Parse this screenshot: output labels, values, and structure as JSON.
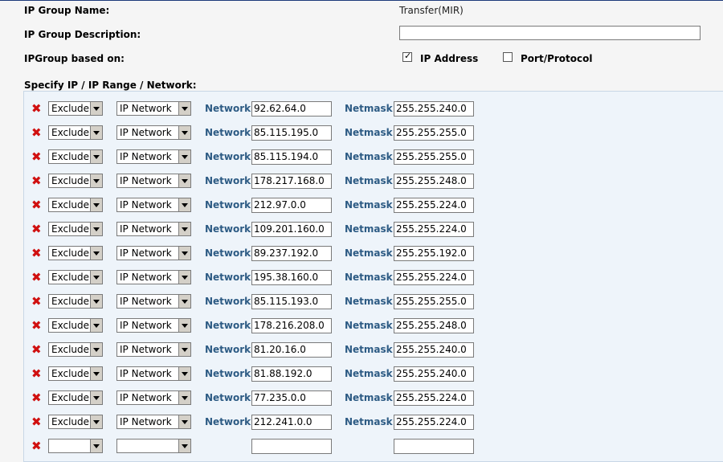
{
  "form": {
    "group_name_label": "IP Group Name:",
    "group_name_value": "Transfer(MIR)",
    "group_desc_label": "IP Group Description:",
    "group_desc_value": "",
    "based_on_label": "IPGroup based on:",
    "ip_address_label": "IP Address",
    "ip_address_checked": true,
    "ip_address_mark": "✓",
    "port_protocol_label": "Port/Protocol",
    "port_protocol_checked": false,
    "specify_label": "Specify IP / IP Range / Network:"
  },
  "colors": {
    "field_label": "#2d5b84",
    "delete_icon": "#d01010",
    "panel_bg": "#eef4fa"
  },
  "rows": [
    {
      "action": "Exclude",
      "type": "IP Network",
      "network_label": "Network",
      "network": "92.62.64.0",
      "netmask_label": "Netmask",
      "netmask": "255.255.240.0"
    },
    {
      "action": "Exclude",
      "type": "IP Network",
      "network_label": "Network",
      "network": "85.115.195.0",
      "netmask_label": "Netmask",
      "netmask": "255.255.255.0"
    },
    {
      "action": "Exclude",
      "type": "IP Network",
      "network_label": "Network",
      "network": "85.115.194.0",
      "netmask_label": "Netmask",
      "netmask": "255.255.255.0"
    },
    {
      "action": "Exclude",
      "type": "IP Network",
      "network_label": "Network",
      "network": "178.217.168.0",
      "netmask_label": "Netmask",
      "netmask": "255.255.248.0"
    },
    {
      "action": "Exclude",
      "type": "IP Network",
      "network_label": "Network",
      "network": "212.97.0.0",
      "netmask_label": "Netmask",
      "netmask": "255.255.224.0"
    },
    {
      "action": "Exclude",
      "type": "IP Network",
      "network_label": "Network",
      "network": "109.201.160.0",
      "netmask_label": "Netmask",
      "netmask": "255.255.224.0"
    },
    {
      "action": "Exclude",
      "type": "IP Network",
      "network_label": "Network",
      "network": "89.237.192.0",
      "netmask_label": "Netmask",
      "netmask": "255.255.192.0"
    },
    {
      "action": "Exclude",
      "type": "IP Network",
      "network_label": "Network",
      "network": "195.38.160.0",
      "netmask_label": "Netmask",
      "netmask": "255.255.224.0"
    },
    {
      "action": "Exclude",
      "type": "IP Network",
      "network_label": "Network",
      "network": "85.115.193.0",
      "netmask_label": "Netmask",
      "netmask": "255.255.255.0"
    },
    {
      "action": "Exclude",
      "type": "IP Network",
      "network_label": "Network",
      "network": "178.216.208.0",
      "netmask_label": "Netmask",
      "netmask": "255.255.248.0"
    },
    {
      "action": "Exclude",
      "type": "IP Network",
      "network_label": "Network",
      "network": "81.20.16.0",
      "netmask_label": "Netmask",
      "netmask": "255.255.240.0"
    },
    {
      "action": "Exclude",
      "type": "IP Network",
      "network_label": "Network",
      "network": "81.88.192.0",
      "netmask_label": "Netmask",
      "netmask": "255.255.240.0"
    },
    {
      "action": "Exclude",
      "type": "IP Network",
      "network_label": "Network",
      "network": "77.235.0.0",
      "netmask_label": "Netmask",
      "netmask": "255.255.224.0"
    },
    {
      "action": "Exclude",
      "type": "IP Network",
      "network_label": "Network",
      "network": "212.241.0.0",
      "netmask_label": "Netmask",
      "netmask": "255.255.224.0"
    },
    {
      "action": "",
      "type": "",
      "network_label": "",
      "network": "",
      "netmask_label": "",
      "netmask": ""
    }
  ]
}
